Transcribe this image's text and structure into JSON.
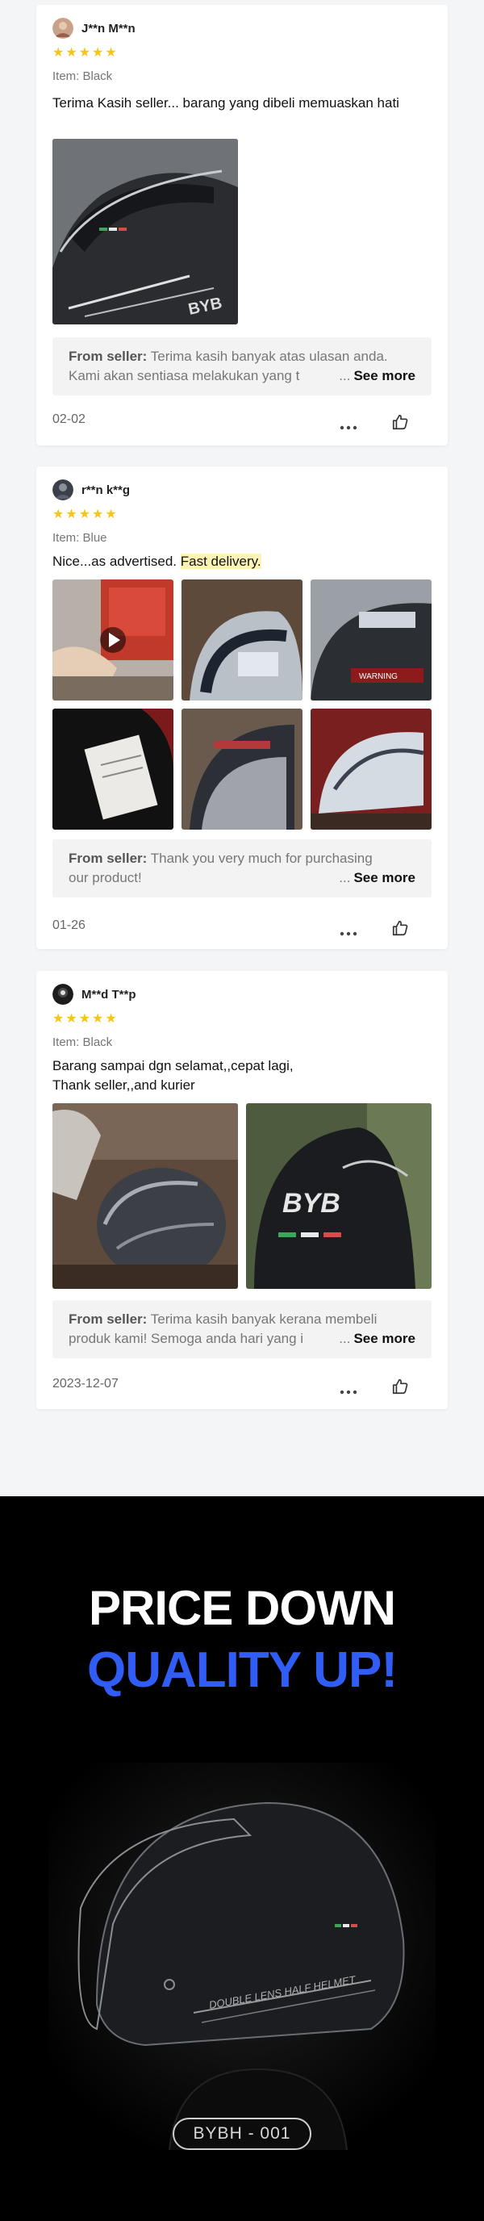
{
  "reviews": [
    {
      "reviewer": "J**n M**n",
      "rating": 5,
      "variant": "Item: Black",
      "text": "Terima Kasih seller... barang yang dibeli memuaskan hati",
      "seller_label": "From seller:",
      "seller_line1": "Terima kasih banyak atas ulasan anda.",
      "seller_line2": "Kami akan sentiasa melakukan yang t",
      "seller_ellipsis": "...",
      "see_more": "See more",
      "date": "02-02"
    },
    {
      "reviewer": "r**n k**g",
      "rating": 5,
      "variant": "Item: Blue",
      "text_plain": "Nice...as advertised.",
      "text_highlight": "Fast delivery.",
      "seller_label": "From seller:",
      "seller_line1": "Thank you very much for purchasing",
      "seller_line2": "our product!",
      "seller_ellipsis": "...",
      "see_more": "See more",
      "date": "01-26"
    },
    {
      "reviewer": "M**d T**p",
      "rating": 5,
      "variant": "Item: Black",
      "text_line1": "Barang sampai dgn selamat,,cepat lagi,",
      "text_line2": "Thank seller,,and kurier",
      "seller_label": "From seller:",
      "seller_line1": "Terima kasih banyak kerana membeli",
      "seller_line2": "produk kami! Semoga anda hari yang i",
      "seller_ellipsis": "...",
      "see_more": "See more",
      "date": "2023-12-07"
    }
  ],
  "icons": {
    "star": "star-icon",
    "more": "more-options-icon",
    "like": "thumbs-up-icon",
    "play": "play-icon"
  },
  "promo": {
    "line1": "PRICE DOWN",
    "line2": "QUALITY UP!",
    "model": "BYBH - 001",
    "helmet_text": "DOUBLE LENS HALF HELMET",
    "accent_color": "#2f5df5"
  },
  "colors": {
    "star": "#f5c518",
    "highlight": "#fcf3b4",
    "seller_box": "#f3f3f4"
  }
}
